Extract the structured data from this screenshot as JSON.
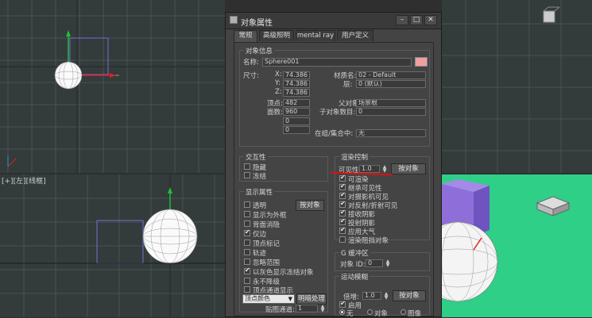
{
  "viewport": {
    "front_label": "[+][左][线框]"
  },
  "dialog": {
    "title": "对象属性",
    "tabs": [
      "常规",
      "高级照明",
      "mental ray",
      "用户定义"
    ],
    "object_info": {
      "group": "对象信息",
      "name_label": "名称:",
      "name_value": "Sphere001",
      "color": "#f0a0a0",
      "dims_label": "尺寸:",
      "x_label": "X:",
      "x_value": "74.386",
      "y_label": "Y:",
      "y_value": "74.386",
      "z_label": "Z:",
      "z_value": "74.386",
      "verts_label": "顶点:",
      "verts_value": "482",
      "faces_label": "面数:",
      "faces_value": "960",
      "blank1": "0",
      "blank2": "0",
      "material_label": "材质名:",
      "material_value": "02 - Default",
      "layer_label": "层:",
      "layer_value": "0 (默认)",
      "parent_label": "父对象:",
      "parent_value": "场景根",
      "children_label": "子对象数目:",
      "children_value": "0",
      "ingroup_label": "在组/集合中:",
      "ingroup_value": "无"
    },
    "interactivity": {
      "group": "交互性",
      "hide": "隐藏",
      "freeze": "冻结"
    },
    "display_props": {
      "group": "显示属性",
      "by_object": "按对象",
      "items": [
        {
          "label": "透明",
          "checked": false
        },
        {
          "label": "显示为外框",
          "checked": false
        },
        {
          "label": "背面消隐",
          "checked": false
        },
        {
          "label": "仅边",
          "checked": true
        },
        {
          "label": "顶点标记",
          "checked": false
        },
        {
          "label": "轨迹",
          "checked": false
        },
        {
          "label": "忽略范围",
          "checked": false
        },
        {
          "label": "以灰色显示冻结对象",
          "checked": true
        },
        {
          "label": "永不降级",
          "checked": false
        },
        {
          "label": "顶点通道显示",
          "checked": false
        }
      ],
      "vertex_color": "顶点颜色",
      "shaded": "明暗处理",
      "map_channel_label": "贴图通道:",
      "map_channel_value": "1"
    },
    "render_control": {
      "group": "渲染控制",
      "visibility_label": "可见性:",
      "visibility_value": "1.0",
      "by_object": "按对象",
      "renderable": "可渲染",
      "items": [
        {
          "label": "继承可见性",
          "checked": true
        },
        {
          "label": "对摄影机可见",
          "checked": true
        },
        {
          "label": "对反射/折射可见",
          "checked": true
        },
        {
          "label": "接收阴影",
          "checked": true
        },
        {
          "label": "投射阴影",
          "checked": true
        },
        {
          "label": "应用大气",
          "checked": true
        },
        {
          "label": "渲染阻挡对象",
          "checked": false
        }
      ]
    },
    "gbuffer": {
      "group": "G 缓冲区",
      "object_id_label": "对象 ID:",
      "object_id_value": "0"
    },
    "motion_blur": {
      "group": "运动模糊",
      "multiplier_label": "倍增:",
      "multiplier_value": "1.0",
      "by_object": "按对象",
      "enable": "启用",
      "options": [
        "无",
        "对象",
        "图像"
      ],
      "selected": 0
    }
  }
}
